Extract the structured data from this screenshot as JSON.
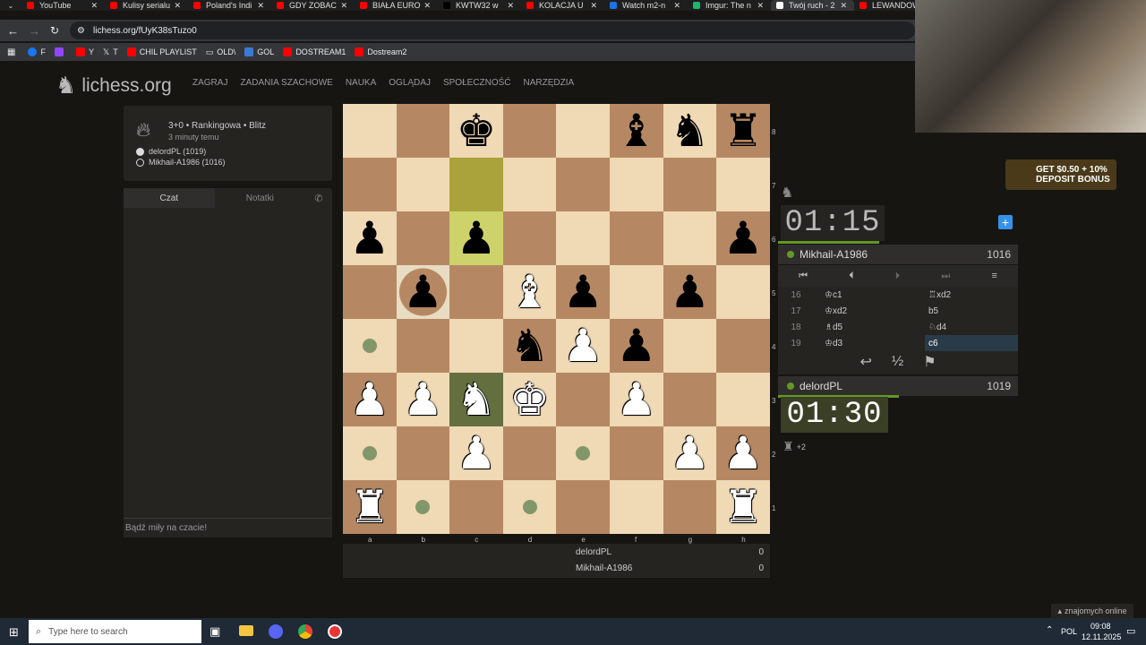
{
  "browser": {
    "tabs": [
      {
        "title": "YouTube",
        "color": "#ff0000"
      },
      {
        "title": "Kulisy serialu",
        "color": "#ff0000"
      },
      {
        "title": "Poland's Indi",
        "color": "#ff0000"
      },
      {
        "title": "GDY ZOBAC",
        "color": "#ff0000"
      },
      {
        "title": "BIAŁA EURO",
        "color": "#ff0000"
      },
      {
        "title": "KWTW32 w",
        "color": "#000000"
      },
      {
        "title": "KOLACJA U",
        "color": "#ff0000"
      },
      {
        "title": "Watch m2-n",
        "color": "#1a73e8"
      },
      {
        "title": "Imgur: The n",
        "color": "#1bb76e"
      },
      {
        "title": "Twój ruch - 2",
        "color": "#ffffff"
      },
      {
        "title": "LEWANDOW",
        "color": "#ff0000"
      }
    ],
    "url": "lichess.org/fUyK38sTuzo0",
    "bookmarks": [
      "F",
      "Y",
      "T",
      "CHIL PLAYLIST",
      "OLD\\",
      "GOL",
      "DOSTREAM1",
      "Dostream2"
    ]
  },
  "site": {
    "logo": "lichess.org",
    "nav": [
      "ZAGRAJ",
      "ZADANIA SZACHOWE",
      "NAUKA",
      "OGLĄDAJ",
      "SPOŁECZNOŚĆ",
      "NARZĘDZIA"
    ]
  },
  "game": {
    "mode": "3+0 • Rankingowa • Blitz",
    "time_ago": "3 minuty temu",
    "white_player": "delordPL (1019)",
    "black_player": "Mikhail-A1986 (1016)"
  },
  "chat": {
    "tab_chat": "Czat",
    "tab_notes": "Notatki",
    "placeholder": "Bądź miły na czacie!"
  },
  "board": {
    "files": [
      "a",
      "b",
      "c",
      "d",
      "e",
      "f",
      "g",
      "h"
    ],
    "ranks": [
      "8",
      "7",
      "6",
      "5",
      "4",
      "3",
      "2",
      "1"
    ],
    "rows": [
      [
        "",
        "",
        "k",
        "",
        "",
        "b",
        "n",
        "r"
      ],
      [
        "",
        "",
        "",
        "",
        "",
        "",
        "",
        ""
      ],
      [
        "p",
        "",
        "p",
        "",
        "",
        "",
        "",
        "p"
      ],
      [
        "",
        "p",
        "",
        "B",
        "p",
        "",
        "p",
        ""
      ],
      [
        "",
        "",
        "",
        "n",
        "P",
        "p",
        "",
        ""
      ],
      [
        "P",
        "P",
        "N",
        "K",
        "",
        "P",
        "",
        ""
      ],
      [
        "",
        "",
        "P",
        "",
        "",
        "",
        "P",
        "P"
      ],
      [
        "R",
        "",
        "",
        "",
        "",
        "",
        "",
        "R"
      ]
    ]
  },
  "opponent": {
    "clock": "01:15",
    "name": "Mikhail-A1986",
    "rating": "1016"
  },
  "me": {
    "clock": "01:30",
    "name": "delordPL",
    "rating": "1019",
    "material": "+2"
  },
  "moves": [
    {
      "n": "16",
      "w": "♔c1",
      "b": "♖xd2"
    },
    {
      "n": "17",
      "w": "♔xd2",
      "b": "b5"
    },
    {
      "n": "18",
      "w": "♗d5",
      "b": "♘d4"
    },
    {
      "n": "19",
      "w": "♔d3",
      "b": "c6"
    }
  ],
  "score": {
    "p1": "delordPL",
    "p1_score": "0",
    "p2": "Mikhail-A1986",
    "p2_score": "0"
  },
  "ad": {
    "line1": "GET $0.50 + 10%",
    "line2": "DEPOSIT BONUS"
  },
  "friends": "znajomych online",
  "taskbar": {
    "search_placeholder": "Type here to search",
    "lang": "POL",
    "time": "09:08",
    "date": "12.11.2025"
  }
}
